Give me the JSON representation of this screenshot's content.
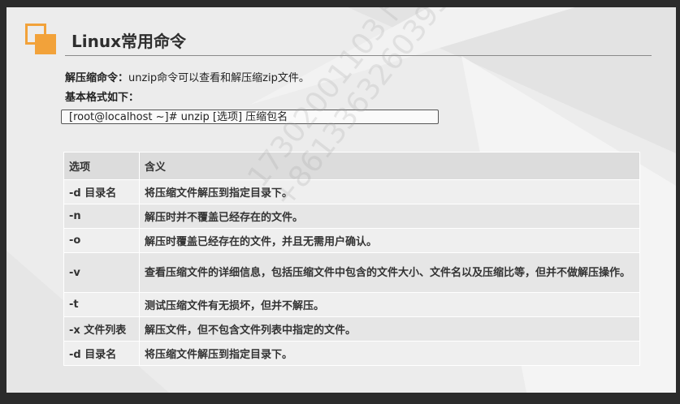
{
  "title": "Linux常用命令",
  "desc": {
    "label": "解压缩命令：",
    "text": "unzip命令可以查看和解压缩zip文件。"
  },
  "format_label": "基本格式如下：",
  "command": "[root@localhost ~]# unzip [选项] 压缩包名",
  "table": {
    "headers": [
      "选项",
      "含义"
    ],
    "rows": [
      {
        "option": "-d 目录名",
        "meaning": "将压缩文件解压到指定目录下。"
      },
      {
        "option": "-n",
        "meaning": "解压时并不覆盖已经存在的文件。"
      },
      {
        "option": "-o",
        "meaning": "解压时覆盖已经存在的文件，并且无需用户确认。"
      },
      {
        "option": "-v",
        "meaning": "查看压缩文件的详细信息，包括压缩文件中包含的文件大小、文件名以及压缩比等，但并不做解压操作。"
      },
      {
        "option": "-t",
        "meaning": "测试压缩文件有无损坏，但并不解压。"
      },
      {
        "option": "-x 文件列表",
        "meaning": "解压文件，但不包含文件列表中指定的文件。"
      },
      {
        "option": "-d 目录名",
        "meaning": "将压缩文件解压到指定目录下。"
      }
    ]
  },
  "watermark": {
    "line1": "17302001103卜一凡",
    "line2": "+8613363260395"
  },
  "colors": {
    "accent": "#f2a23a",
    "header_bg": "#dcdcdc",
    "row_bg": "#e6e6e6"
  }
}
